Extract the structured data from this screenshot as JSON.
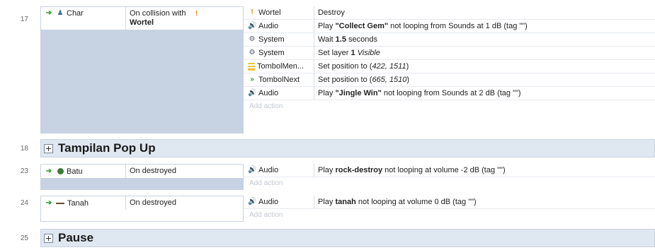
{
  "events": [
    {
      "number": "17",
      "object": "Char",
      "condition_prefix": "On collision with",
      "condition_object": "Wortel",
      "actions": [
        {
          "object": "Wortel",
          "icon": "carrot-icon",
          "parts": [
            "Destroy"
          ]
        },
        {
          "object": "Audio",
          "icon": "audio-icon",
          "parts": [
            "Play ",
            "\"Collect Gem\"",
            " not looping from Sounds at 1 dB (tag \"\")"
          ]
        },
        {
          "object": "System",
          "icon": "gear-icon",
          "parts": [
            "Wait ",
            "1.5",
            " seconds"
          ]
        },
        {
          "object": "System",
          "icon": "gear-icon",
          "parts": [
            "Set layer ",
            "1",
            " ",
            "Visible"
          ]
        },
        {
          "object": "TombolMen...",
          "icon": "menu-icon",
          "parts": [
            "Set position to (",
            "422, 1511",
            ")"
          ]
        },
        {
          "object": "TombolNext",
          "icon": "next-icon",
          "parts": [
            "Set position to (",
            "665, 1510",
            ")"
          ]
        },
        {
          "object": "Audio",
          "icon": "audio-icon",
          "parts": [
            "Play ",
            "\"Jingle Win\"",
            " not looping from Sounds at 2 dB (tag \"\")"
          ]
        }
      ],
      "add_action": "Add action"
    },
    {
      "number": "23",
      "object": "Batu",
      "condition": "On destroyed",
      "actions": [
        {
          "object": "Audio",
          "icon": "audio-icon",
          "parts": [
            "Play ",
            "rock-destroy",
            " not looping at volume -2 dB (tag \"\")"
          ]
        }
      ],
      "add_action": "Add action"
    },
    {
      "number": "24",
      "object": "Tanah",
      "condition": "On destroyed",
      "actions": [
        {
          "object": "Audio",
          "icon": "audio-icon",
          "parts": [
            "Play ",
            "tanah",
            " not looping at volume 0 dB (tag \"\")"
          ]
        }
      ],
      "add_action": "Add action"
    }
  ],
  "groups": [
    {
      "number": "18",
      "title": "Tampilan Pop Up"
    },
    {
      "number": "25",
      "title": "Pause"
    }
  ],
  "colors": {
    "accent": "#2ea02e",
    "group_bg": "#dfe7f1",
    "condition_filler": "#c7d3e2"
  }
}
